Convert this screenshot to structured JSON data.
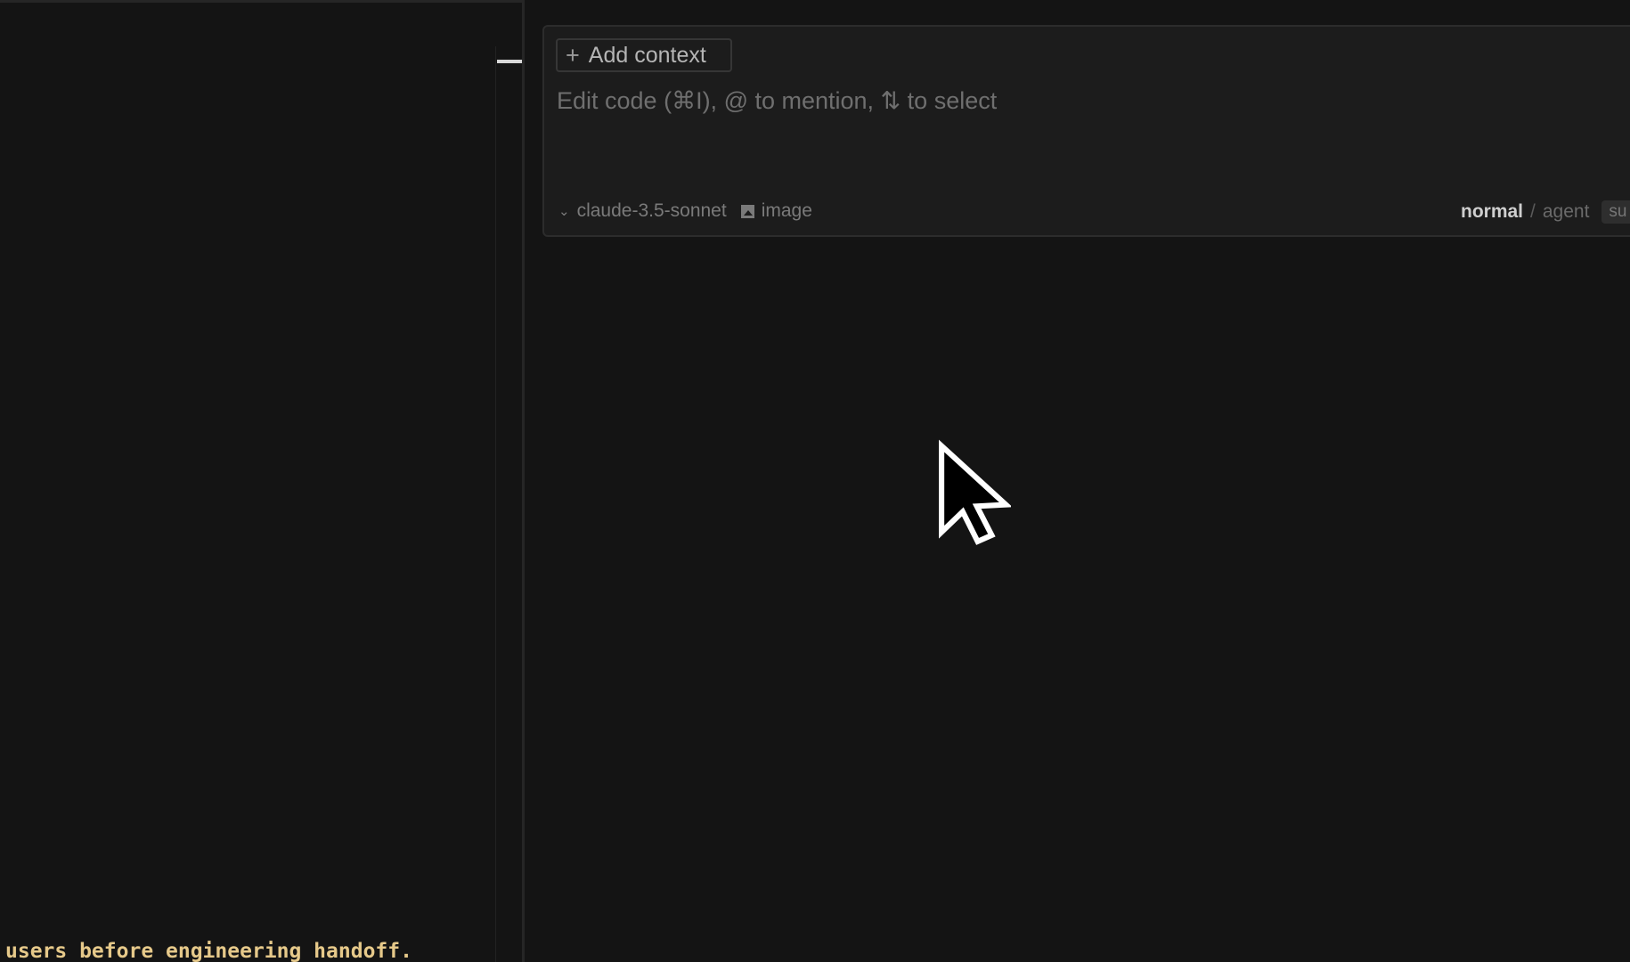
{
  "editor": {
    "visible_line": "users before engineering handoff."
  },
  "chat": {
    "add_context_label": "Add context",
    "placeholder": "Edit code (⌘I), @ to mention, ⇅ to select",
    "model_name": "claude-3.5-sonnet",
    "image_label": "image",
    "mode_normal": "normal",
    "mode_separator": "/",
    "mode_agent": "agent",
    "submit_label": "su"
  },
  "icons": {
    "plus": "plus-icon",
    "chevron": "chevron-down-icon",
    "image": "image-icon",
    "cursor": "mouse-pointer-icon"
  },
  "colors": {
    "background": "#141414",
    "input_background": "#1c1c1c",
    "editor_text": "#e6c98a"
  }
}
